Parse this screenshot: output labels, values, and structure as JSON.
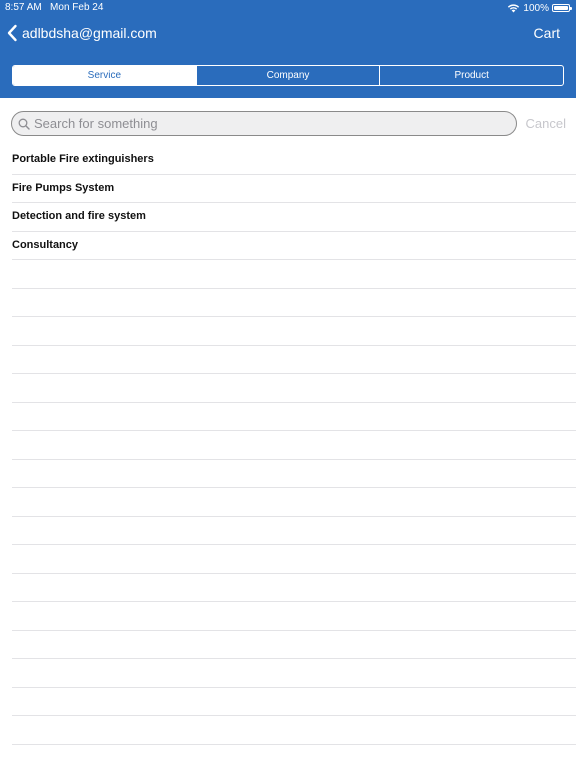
{
  "status_bar": {
    "time": "8:57 AM",
    "date": "Mon Feb 24",
    "battery_percent": "100%",
    "wifi_icon": "wifi-icon",
    "battery_icon": "battery-icon"
  },
  "nav": {
    "back_icon": "chevron-left-icon",
    "back_label": "adlbdsha@gmail.com",
    "cart_label": "Cart"
  },
  "segments": [
    {
      "label": "Service",
      "selected": true
    },
    {
      "label": "Company",
      "selected": false
    },
    {
      "label": "Product",
      "selected": false
    }
  ],
  "search": {
    "icon": "search-icon",
    "placeholder": "Search for something",
    "value": "",
    "cancel_label": "Cancel"
  },
  "list": {
    "items": [
      {
        "label": "Portable Fire extinguishers"
      },
      {
        "label": "Fire Pumps System"
      },
      {
        "label": "Detection and fire system"
      },
      {
        "label": "Consultancy"
      }
    ],
    "empty_rows": 18
  },
  "colors": {
    "header_blue": "#2a6cbc",
    "separator": "#e3e3e6",
    "cancel_text": "#c7c7cc"
  }
}
